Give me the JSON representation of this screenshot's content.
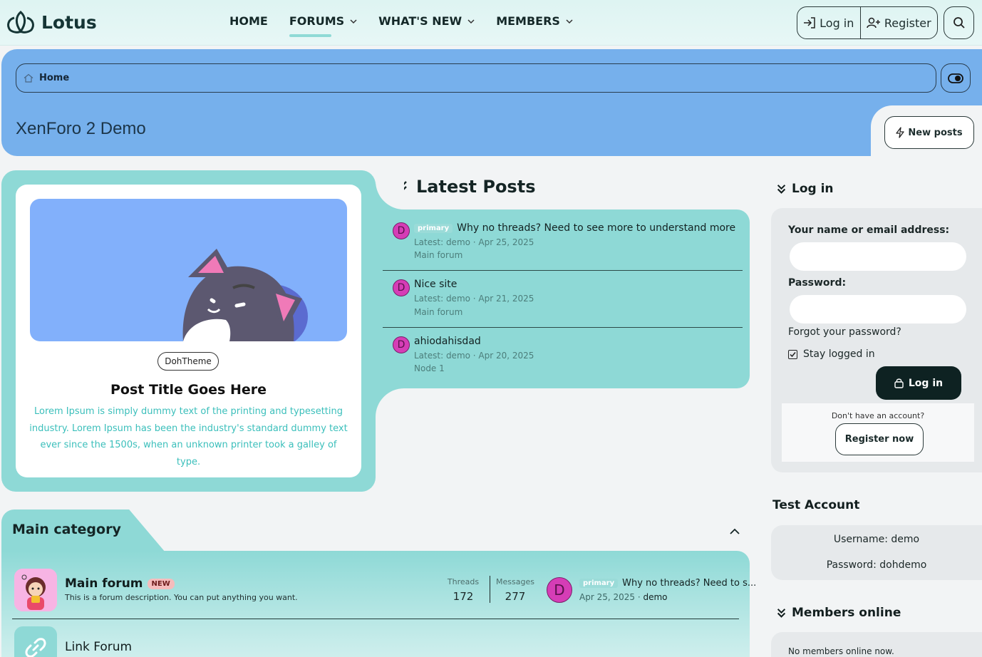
{
  "header": {
    "logo_text": "Lotus",
    "nav": [
      {
        "label": "HOME",
        "has_dropdown": false,
        "active": false
      },
      {
        "label": "FORUMS",
        "has_dropdown": true,
        "active": true
      },
      {
        "label": "WHAT'S NEW",
        "has_dropdown": true,
        "active": false
      },
      {
        "label": "MEMBERS",
        "has_dropdown": true,
        "active": false
      }
    ],
    "login_label": "Log in",
    "register_label": "Register"
  },
  "banner": {
    "breadcrumb_home": "Home",
    "page_title": "XenForo 2 Demo",
    "new_posts_label": "New posts"
  },
  "featured": {
    "tag": "DohTheme",
    "title": "Post Title Goes Here",
    "description": "Lorem Ipsum is simply dummy text of the printing and typesetting industry. Lorem Ipsum has been the industry's standard dummy text ever since the 1500s, when an unknown printer took a galley of type."
  },
  "latest_posts": {
    "heading": "Latest Posts",
    "items": [
      {
        "avatar": "D",
        "prefix": "primary",
        "title": "Why no threads? Need to see more to understand more",
        "meta": "Latest: demo · Apr 25, 2025",
        "forum": "Main forum"
      },
      {
        "avatar": "D",
        "prefix": "",
        "title": "Nice site",
        "meta": "Latest: demo · Apr 21, 2025",
        "forum": "Main forum"
      },
      {
        "avatar": "D",
        "prefix": "",
        "title": "ahiodahisdad",
        "meta": "Latest: demo · Apr 20, 2025",
        "forum": "Node 1"
      }
    ]
  },
  "sidebar": {
    "login_heading": "Log in",
    "name_label": "Your name or email address:",
    "password_label": "Password:",
    "forgot": "Forgot your password?",
    "stay_logged_in": "Stay logged in",
    "submit": "Log in",
    "no_account": "Don't have an account?",
    "register_now": "Register now",
    "test_heading": "Test Account",
    "test_username": "Username: demo",
    "test_password": "Password: dohdemo",
    "members_heading": "Members online",
    "members_text": "No members online now."
  },
  "category": {
    "title": "Main category",
    "forums": [
      {
        "name": "Main forum",
        "badge": "NEW",
        "description": "This is a forum description. You can put anything you want.",
        "threads_label": "Threads",
        "threads": "172",
        "messages_label": "Messages",
        "messages": "277",
        "last_avatar": "D",
        "last_prefix": "primary",
        "last_title": "Why no threads? Need to s...",
        "last_date": "Apr 25, 2025 · ",
        "last_user": "demo"
      },
      {
        "name": "Link Forum"
      }
    ]
  },
  "colors": {
    "teal": "#8ed9d6",
    "blue_banner": "#76b0ec",
    "dark_button": "#0e2222",
    "avatar_magenta": "#d53db6"
  }
}
